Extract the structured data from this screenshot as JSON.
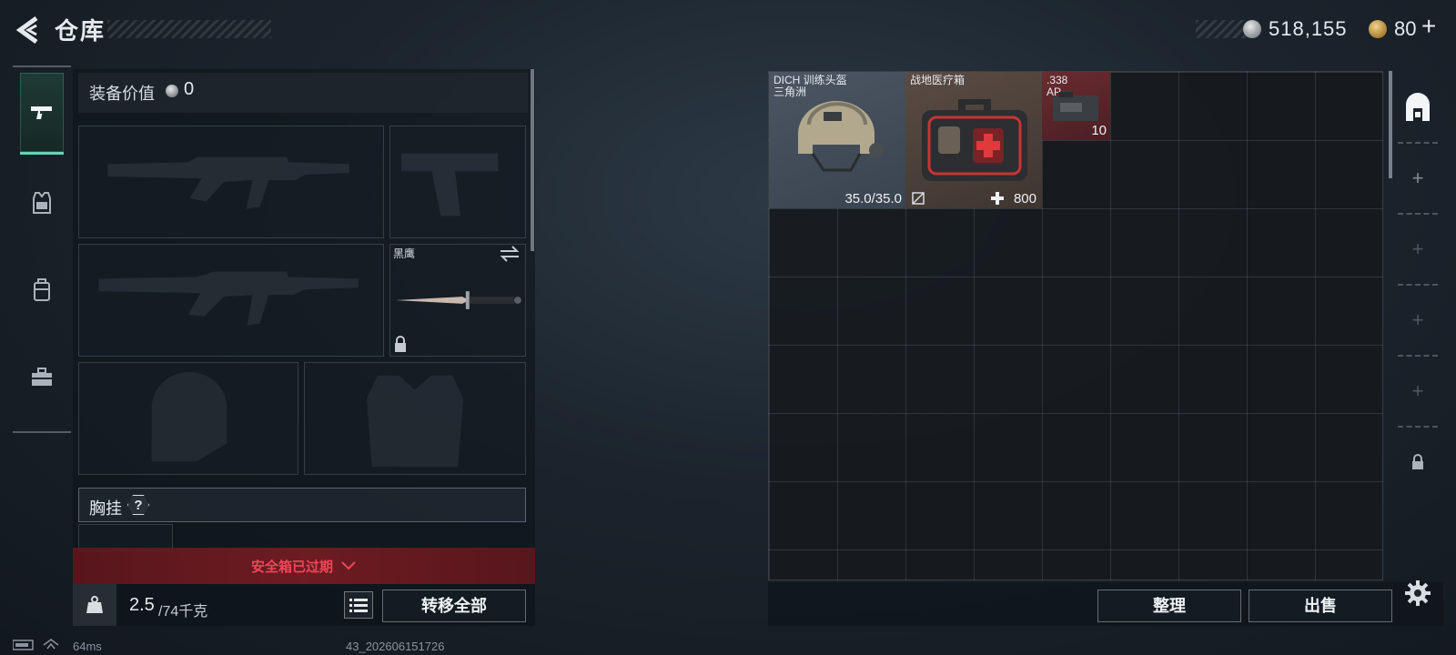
{
  "header": {
    "title": "仓库",
    "currency_silver": "518,155",
    "currency_gold": "80",
    "currency_add": "+"
  },
  "left_nav": {
    "tabs": [
      {
        "name": "weapons",
        "icon": "pistol-icon",
        "active": true
      },
      {
        "name": "armor",
        "icon": "rig-icon",
        "active": false
      },
      {
        "name": "backpack",
        "icon": "backpack-icon",
        "active": false
      },
      {
        "name": "toolbox",
        "icon": "toolbox-icon",
        "active": false
      }
    ]
  },
  "equipment": {
    "value_label": "装备价值",
    "value": "0",
    "knife_name": "黑鹰",
    "chest_rig_label": "胸挂",
    "chest_rig_help": "?"
  },
  "safe_box": {
    "status": "安全箱已过期"
  },
  "capacity": {
    "current": "2.5",
    "max": "/74千克",
    "transfer_all": "转移全部"
  },
  "stash": {
    "items": [
      {
        "name_line1": "DICH 训练头盔",
        "name_line2": "三角洲",
        "value": "35.0/35.0"
      },
      {
        "name_line1": "战地医疗箱",
        "value": "800"
      },
      {
        "name_line1": ".338",
        "name_line2": "AP",
        "value": "10"
      }
    ],
    "sort_button": "整理",
    "sell_button": "出售"
  },
  "status_bar": {
    "ping": "64ms",
    "build": "43_202606151726"
  },
  "colors": {
    "accent": "#62d6b6",
    "warning": "#f0465a",
    "ammo_bg": "#6a2c30"
  }
}
